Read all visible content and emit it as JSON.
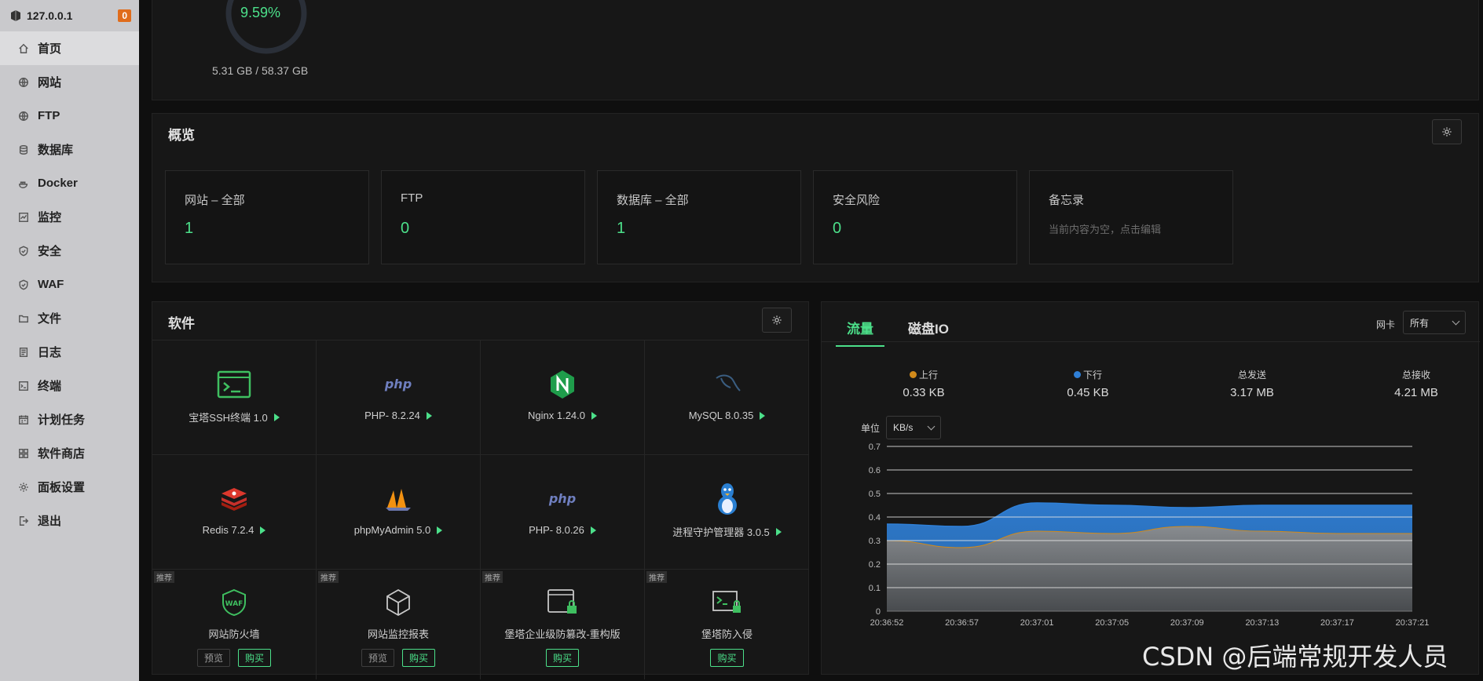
{
  "sidebar": {
    "host": "127.0.0.1",
    "badge": "0",
    "items": [
      {
        "label": "首页",
        "icon": "home-icon",
        "active": true
      },
      {
        "label": "网站",
        "icon": "globe-icon"
      },
      {
        "label": "FTP",
        "icon": "globe-icon"
      },
      {
        "label": "数据库",
        "icon": "database-icon"
      },
      {
        "label": "Docker",
        "icon": "docker-icon"
      },
      {
        "label": "监控",
        "icon": "monitor-icon"
      },
      {
        "label": "安全",
        "icon": "shield-icon"
      },
      {
        "label": "WAF",
        "icon": "shield-icon"
      },
      {
        "label": "文件",
        "icon": "folder-icon"
      },
      {
        "label": "日志",
        "icon": "log-icon"
      },
      {
        "label": "终端",
        "icon": "terminal-icon"
      },
      {
        "label": "计划任务",
        "icon": "calendar-icon"
      },
      {
        "label": "软件商店",
        "icon": "apps-icon"
      },
      {
        "label": "面板设置",
        "icon": "gear-icon"
      },
      {
        "label": "退出",
        "icon": "logout-icon"
      }
    ]
  },
  "disk": {
    "percent": "9.59%",
    "percent_value": 9.59,
    "size": "5.31 GB / 58.37 GB"
  },
  "overview": {
    "title": "概览",
    "cards": [
      {
        "title": "网站 – 全部",
        "value": "1"
      },
      {
        "title": "FTP",
        "value": "0"
      },
      {
        "title": "数据库 – 全部",
        "value": "1"
      },
      {
        "title": "安全风险",
        "value": "0"
      },
      {
        "title": "备忘录",
        "note": "当前内容为空，点击编辑"
      }
    ]
  },
  "software": {
    "title": "软件",
    "rows": [
      [
        {
          "name": "宝塔SSH终端 1.0",
          "icon": "terminal-icon"
        },
        {
          "name": "PHP- 8.2.24",
          "icon": "php-icon"
        },
        {
          "name": "Nginx 1.24.0",
          "icon": "nginx-icon"
        },
        {
          "name": "MySQL 8.0.35",
          "icon": "mysql-icon"
        }
      ],
      [
        {
          "name": "Redis 7.2.4",
          "icon": "redis-icon"
        },
        {
          "name": "phpMyAdmin 5.0",
          "icon": "phpmyadmin-icon"
        },
        {
          "name": "PHP- 8.0.26",
          "icon": "php-icon"
        },
        {
          "name": "进程守护管理器 3.0.5",
          "icon": "linux-icon"
        }
      ]
    ],
    "promos": [
      {
        "tag": "推荐",
        "name": "网站防火墙",
        "icon": "waf-icon",
        "preview": "预览",
        "buy": "购买"
      },
      {
        "tag": "推荐",
        "name": "网站监控报表",
        "icon": "cube-icon",
        "preview": "预览",
        "buy": "购买"
      },
      {
        "tag": "推荐",
        "name": "堡塔企业级防篡改-重构版",
        "icon": "lock-window-icon",
        "buy": "购买"
      },
      {
        "tag": "推荐",
        "name": "堡塔防入侵",
        "icon": "terminal-lock-icon",
        "buy": "购买"
      }
    ]
  },
  "traffic": {
    "tabs": [
      "流量",
      "磁盘IO"
    ],
    "nic_label": "网卡",
    "nic_value": "所有",
    "stats": [
      {
        "label": "上行",
        "value": "0.33 KB",
        "color": "#d18a1a"
      },
      {
        "label": "下行",
        "value": "0.45 KB",
        "color": "#2f7fd6"
      },
      {
        "label": "总发送",
        "value": "3.17 MB"
      },
      {
        "label": "总接收",
        "value": "4.21 MB"
      }
    ],
    "unit_label": "单位",
    "unit_value": "KB/s"
  },
  "chart_data": {
    "type": "area",
    "x": [
      "20:36:52",
      "20:36:57",
      "20:37:01",
      "20:37:05",
      "20:37:09",
      "20:37:13",
      "20:37:17",
      "20:37:21"
    ],
    "series": [
      {
        "name": "上行",
        "values": [
          0.3,
          0.27,
          0.34,
          0.33,
          0.36,
          0.34,
          0.33,
          0.33
        ],
        "color": "#8a8a8a"
      },
      {
        "name": "下行",
        "values": [
          0.37,
          0.36,
          0.46,
          0.45,
          0.44,
          0.45,
          0.45,
          0.45
        ],
        "color": "#2f7fd6"
      }
    ],
    "yticks": [
      "0",
      "0.1",
      "0.2",
      "0.3",
      "0.4",
      "0.5",
      "0.6",
      "0.7"
    ],
    "ylim": [
      0,
      0.7
    ],
    "grid": true
  },
  "watermark": "CSDN @后端常规开发人员"
}
